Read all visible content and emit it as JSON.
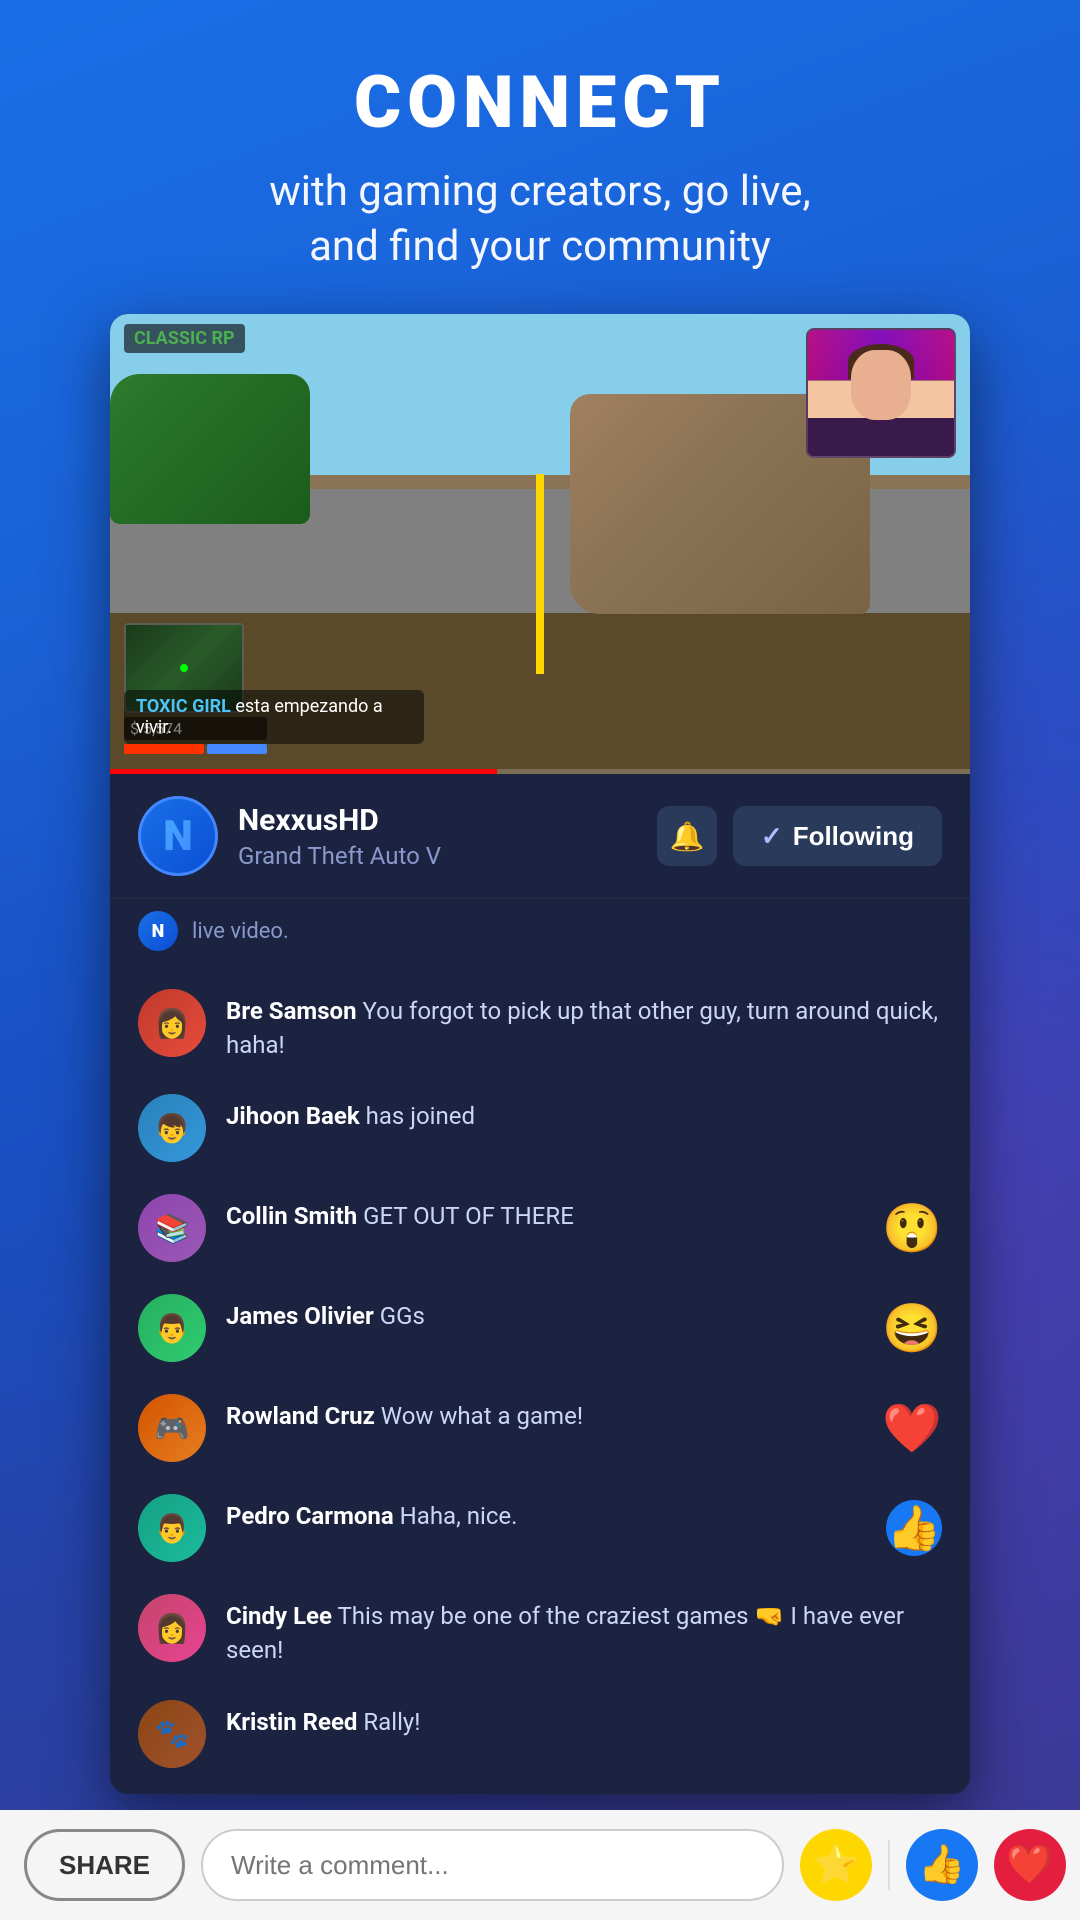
{
  "header": {
    "title": "CONNECT",
    "subtitle": "with gaming creators, go live,\nand find your community"
  },
  "video": {
    "hud_tag": "CLASSIC RP",
    "chat_overlay_name": "TOXIC GIRL",
    "chat_overlay_text": "esta empezando\na vivir.",
    "stat_money": "$ 5,574"
  },
  "streamer": {
    "name": "NexxusHD",
    "game": "Grand Theft Auto V",
    "avatar_letter": "N",
    "live_notice": "live video."
  },
  "buttons": {
    "bell_icon": "🔔",
    "following_check": "✓",
    "following_label": "Following"
  },
  "comments": [
    {
      "author": "Bre Samson",
      "text": " You forgot to pick up that other guy, turn around quick, haha!",
      "emoji": null,
      "avatar_class": "av1",
      "avatar_icon": "👩"
    },
    {
      "author": "Jihoon Baek",
      "text": " has joined",
      "emoji": null,
      "avatar_class": "av2",
      "avatar_icon": "👦"
    },
    {
      "author": "Collin Smith",
      "text": " GET OUT OF THERE",
      "emoji": "😲",
      "avatar_class": "av3",
      "avatar_icon": "📚"
    },
    {
      "author": "James Olivier",
      "text": " GGs",
      "emoji": "😆",
      "avatar_class": "av4",
      "avatar_icon": "👨"
    },
    {
      "author": "Rowland Cruz",
      "text": " Wow what a game!",
      "emoji": "❤️",
      "avatar_class": "av5",
      "avatar_icon": "🎮"
    },
    {
      "author": "Pedro Carmona",
      "text": " Haha, nice.",
      "emoji": "👍",
      "avatar_class": "av6",
      "avatar_icon": "👨"
    },
    {
      "author": "Cindy Lee",
      "text": " This may be one of the craziest games 🤜 I have ever seen!",
      "emoji": null,
      "avatar_class": "av7",
      "avatar_icon": "👩"
    },
    {
      "author": "Kristin Reed",
      "text": " Rally!",
      "emoji": null,
      "avatar_class": "av8",
      "avatar_icon": "🐾"
    }
  ],
  "bottom_bar": {
    "share_label": "SHARE",
    "comment_placeholder": "Write a comment...",
    "star_icon": "⭐",
    "like_icon": "👍",
    "love_icon": "❤️"
  }
}
